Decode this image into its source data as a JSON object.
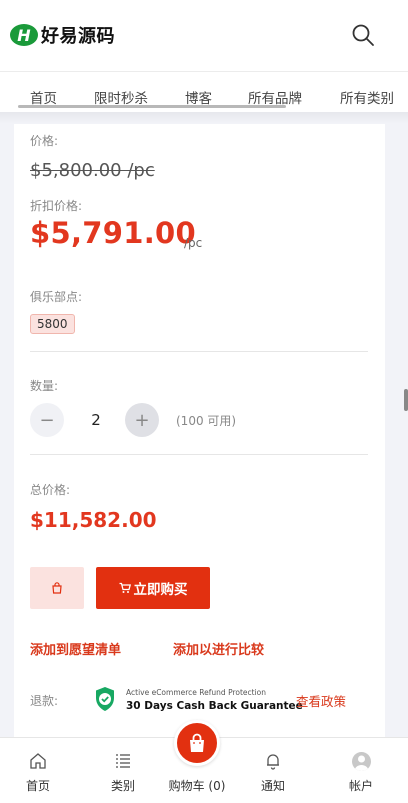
{
  "header": {
    "logo_mark": "H",
    "logo_text": "好易源码"
  },
  "nav": {
    "items": [
      "首页",
      "限时秒杀",
      "博客",
      "所有品牌",
      "所有类别"
    ]
  },
  "product": {
    "price_label": "价格:",
    "original_price": "$5,800.00 /pc",
    "discount_label": "折扣价格:",
    "discount_price": "$5,791.00",
    "unit": "/pc",
    "club_points_label": "俱乐部点:",
    "club_points": "5800",
    "quantity_label": "数量:",
    "quantity": "2",
    "minus": "−",
    "plus": "+",
    "stock_text": "(100 可用)",
    "total_label": "总价格:",
    "total_price": "$11,582.00",
    "buy_now": "立即购买",
    "add_wishlist": "添加到愿望清单",
    "add_compare": "添加以进行比较",
    "refund_label": "退款:",
    "refund_small": "Active eCommerce Refund Protection",
    "refund_big": "30 Days Cash Back Guarantee",
    "view_policy": "查看政策"
  },
  "bottom_nav": {
    "home": "首页",
    "categories": "类别",
    "cart": "购物车 (0)",
    "notifications": "通知",
    "account": "帐户"
  },
  "colors": {
    "accent": "#e23010",
    "brand_green": "#1a9a3a"
  },
  "icons": [
    "search-icon",
    "shopping-bag-icon",
    "cart-icon",
    "shield-check-icon",
    "home-icon",
    "list-icon",
    "bell-icon",
    "user-icon"
  ]
}
